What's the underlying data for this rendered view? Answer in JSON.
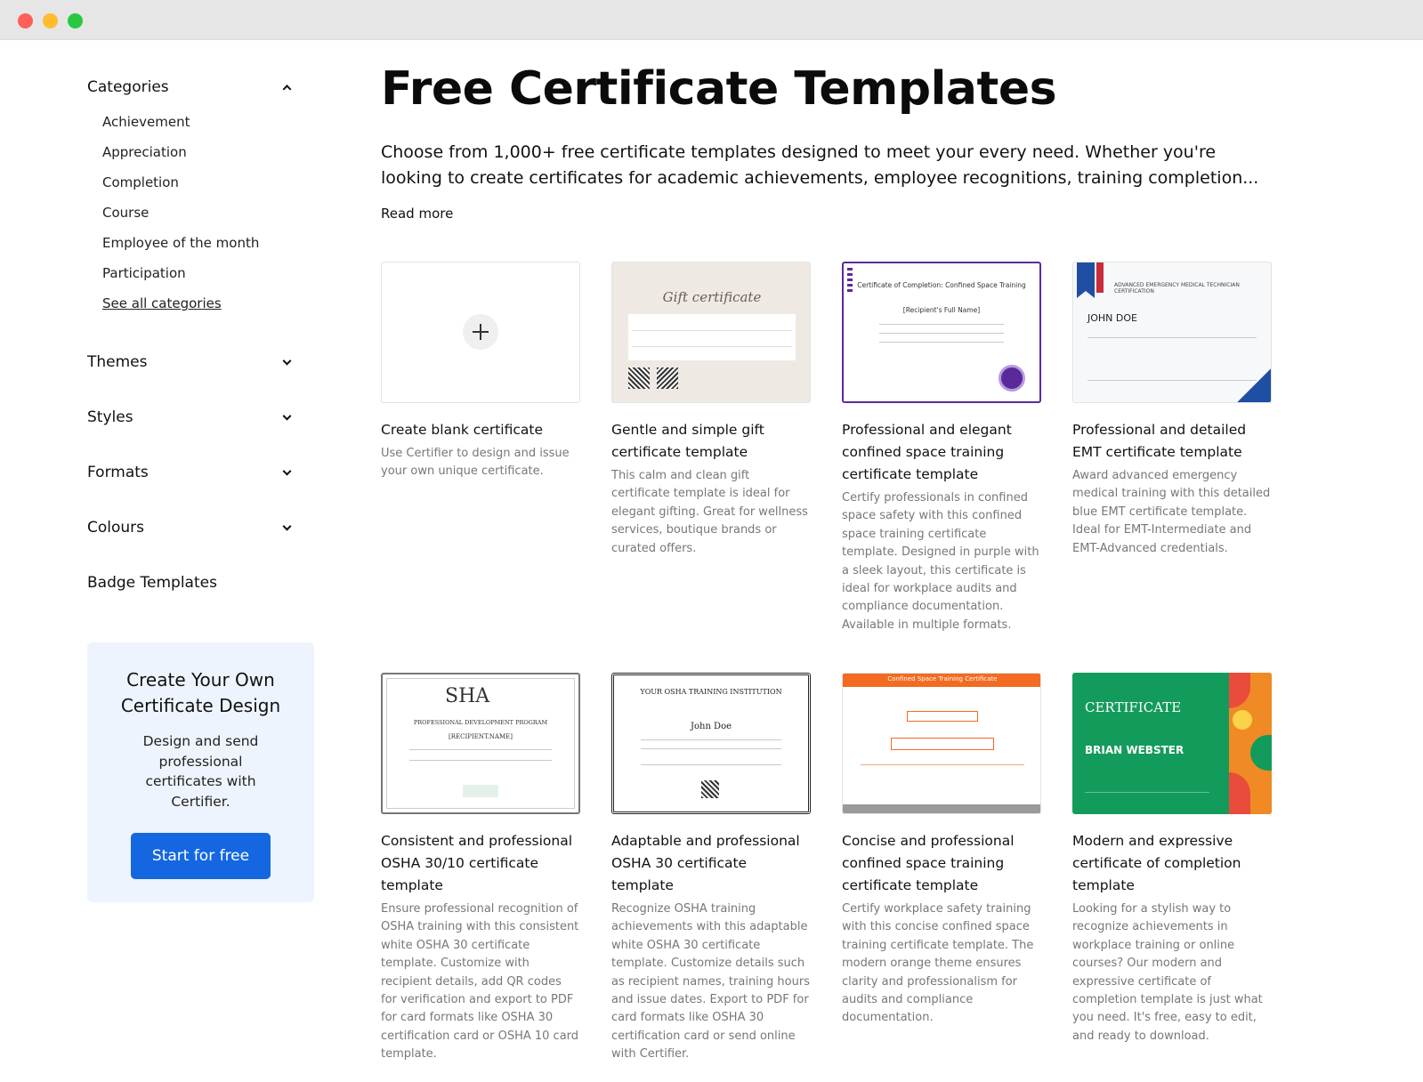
{
  "window": {
    "controls": [
      "close",
      "minimize",
      "zoom"
    ]
  },
  "sidebar": {
    "categories": {
      "label": "Categories",
      "items": [
        "Achievement",
        "Appreciation",
        "Completion",
        "Course",
        "Employee of the month",
        "Participation"
      ],
      "see_all": "See all categories"
    },
    "sections": [
      "Themes",
      "Styles",
      "Formats",
      "Colours"
    ],
    "badge_templates": "Badge Templates",
    "promo": {
      "title": "Create Your Own Certificate Design",
      "body": "Design and send professional certificates with Certifier.",
      "cta": "Start for free"
    }
  },
  "main": {
    "title": "Free Certificate Templates",
    "intro": "Choose from 1,000+ free certificate templates designed to meet your every need. Whether you're looking to create certificates for academic achievements, employee recognitions, training completion...",
    "read_more": "Read more"
  },
  "cards": [
    {
      "title": "Create blank certificate",
      "desc": "Use Certifier to design and issue your own unique certificate.",
      "thumb_text": ""
    },
    {
      "title": "Gentle and simple gift certificate template",
      "desc": "This calm and clean gift certificate template is ideal for elegant gifting. Great for wellness services, boutique brands or curated offers.",
      "thumb_text": "Gift certificate"
    },
    {
      "title": "Professional and elegant confined space training certificate template",
      "desc": "Certify professionals in confined space safety with this confined space training certificate template. Designed in purple with a sleek layout, this certificate is ideal for workplace audits and compliance documentation. Available in multiple formats.",
      "thumb_text": "Certificate of Completion: Confined Space Training",
      "thumb_sub": "[Recipient's Full Name]"
    },
    {
      "title": "Professional and detailed EMT certificate template",
      "desc": "Award advanced emergency medical training with this detailed blue EMT certificate template. Ideal for EMT-Intermediate and EMT-Advanced credentials.",
      "thumb_text": "JOHN DOE",
      "thumb_sub": "ADVANCED EMERGENCY MEDICAL TECHNICIAN CERTIFICATION"
    },
    {
      "title": "Consistent and professional OSHA 30/10 certificate template",
      "desc": "Ensure professional recognition of OSHA training with this consistent white OSHA 30 certificate template. Customize with recipient details, add QR codes for verification and export to PDF for card formats like OSHA 30 certification card or OSHA 10 card template.",
      "thumb_text": "SHA",
      "thumb_sub": "PROFESSIONAL DEVELOPMENT PROGRAM",
      "thumb_name": "[RECIPIENT.NAME]"
    },
    {
      "title": "Adaptable and professional OSHA 30 certificate template",
      "desc": "Recognize OSHA training achievements with this adaptable white OSHA 30 certificate template. Customize details such as recipient names, training hours and issue dates. Export to PDF for card formats like OSHA 30 certification card or send online with Certifier.",
      "thumb_text": "YOUR OSHA TRAINING INSTITUTION",
      "thumb_sub": "John Doe"
    },
    {
      "title": "Concise and professional confined space training certificate template",
      "desc": "Certify workplace safety training with this concise confined space training certificate template. The modern orange theme ensures clarity and professionalism for audits and compliance documentation.",
      "thumb_text": "Confined Space Training Certificate"
    },
    {
      "title": "Modern and expressive certificate of completion template",
      "desc": "Looking for a stylish way to recognize achievements in workplace training or online courses? Our modern and expressive certificate of completion template is just what you need. It's free, easy to edit, and ready to download.",
      "thumb_text": "CERTIFICATE",
      "thumb_sub": "BRIAN WEBSTER"
    }
  ],
  "colors": {
    "cta": "#1467e0",
    "promo_bg": "#eef4fd",
    "purple_accent": "#5b2a9a",
    "emt_blue": "#1f4fa3",
    "orange": "#f26b21",
    "green": "#139b5c"
  }
}
